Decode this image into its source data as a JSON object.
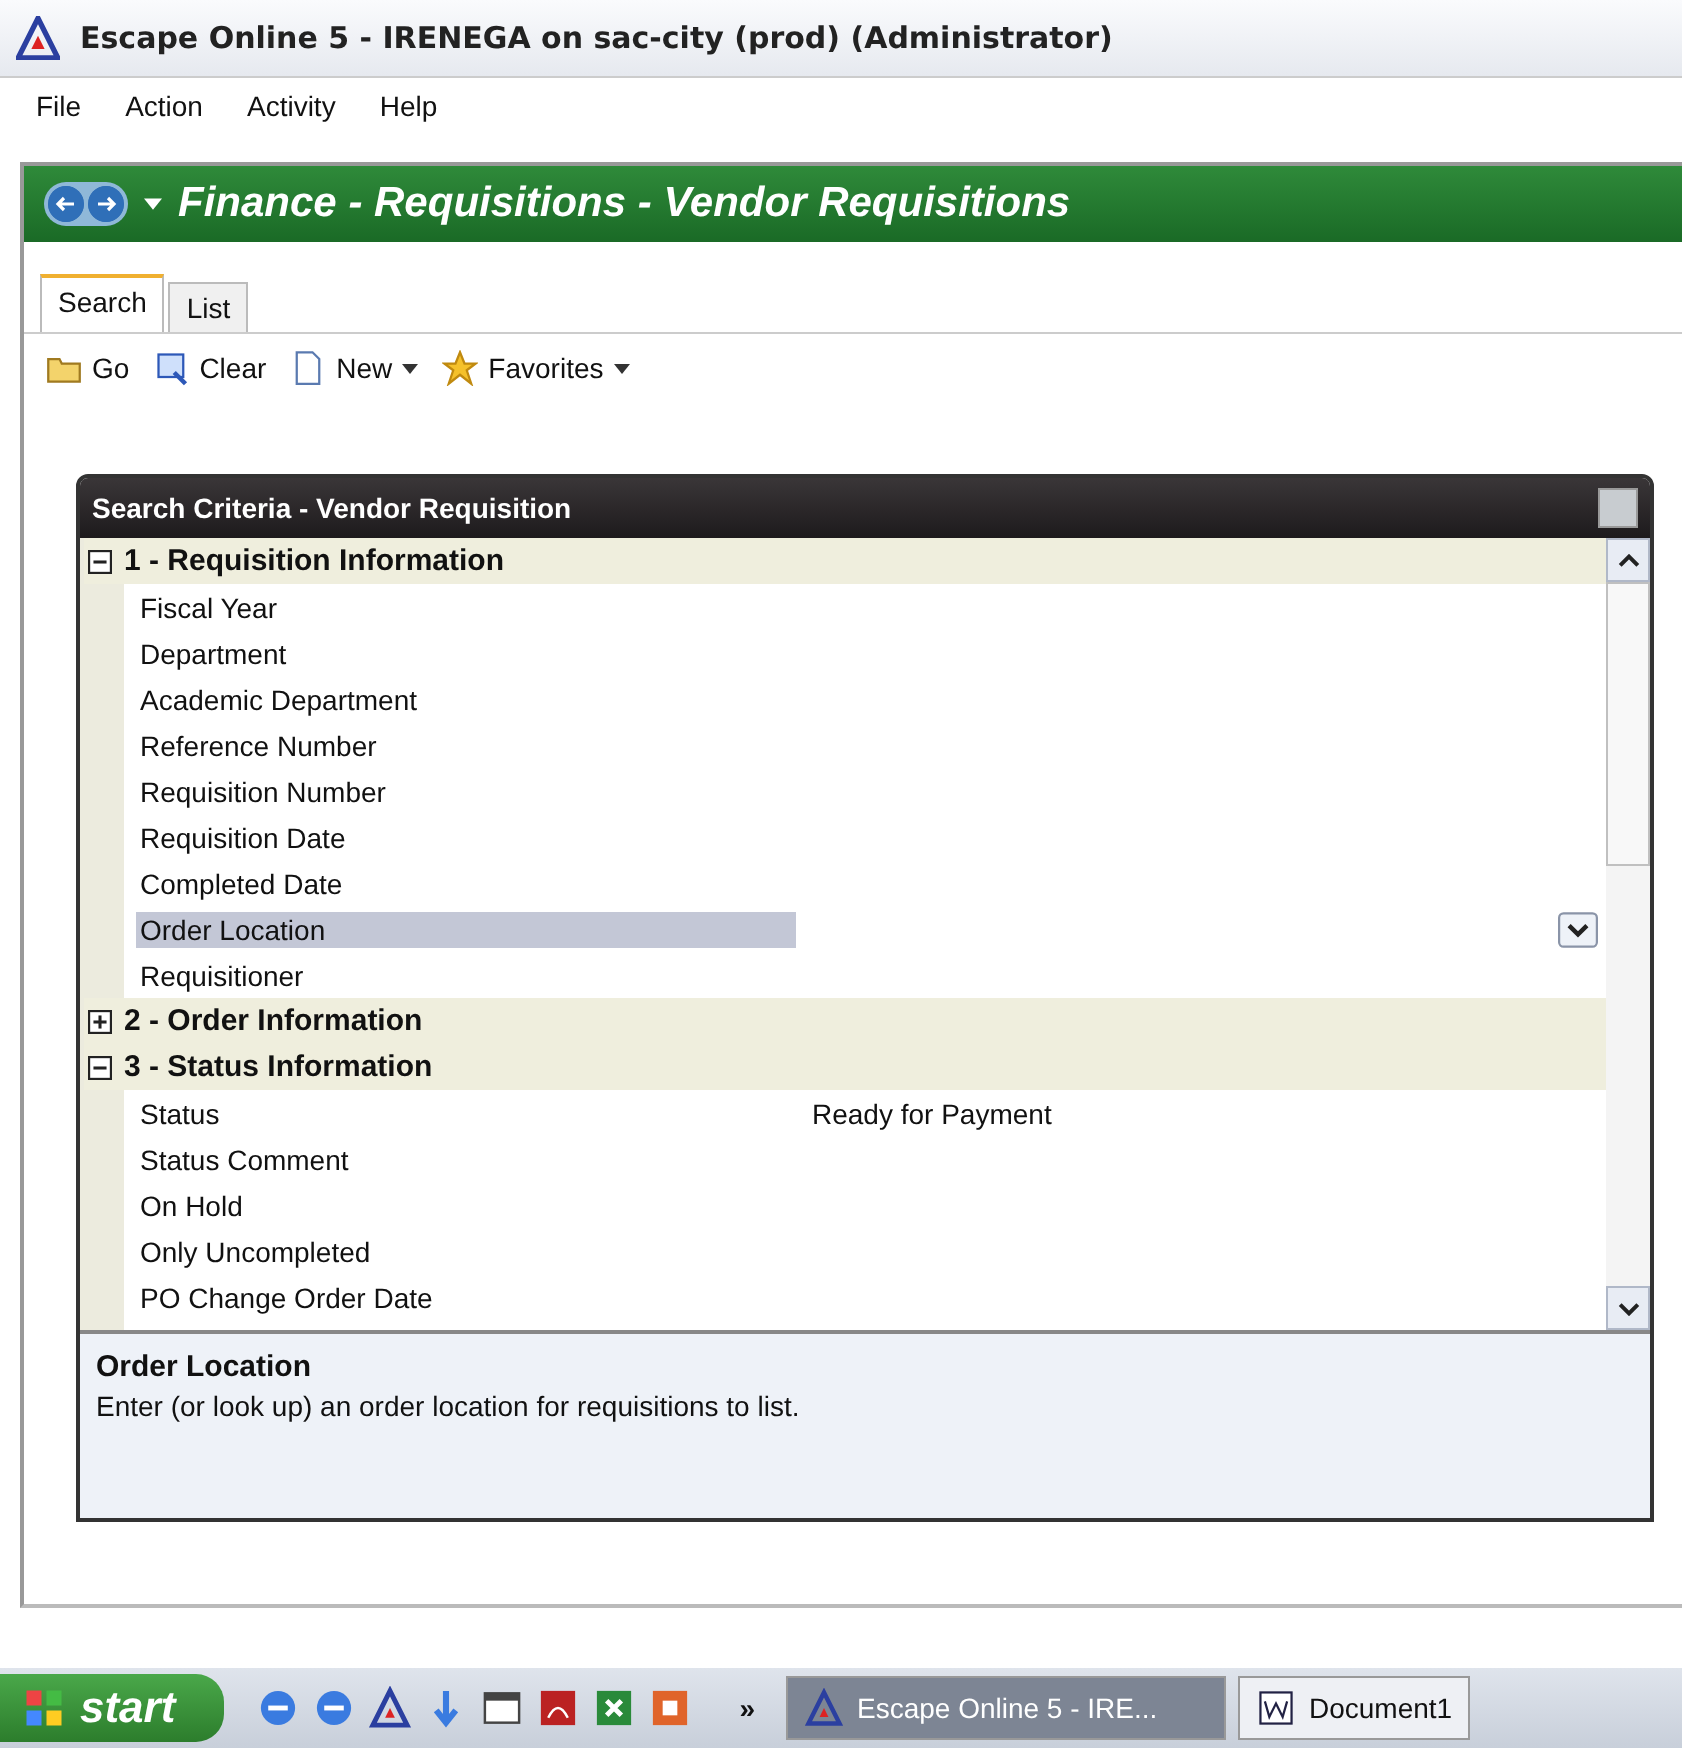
{
  "window": {
    "title": "Escape Online 5 - IRENEGA on sac-city (prod) (Administrator)"
  },
  "menu": [
    "File",
    "Action",
    "Activity",
    "Help"
  ],
  "breadcrumb": "Finance - Requisitions - Vendor Requisitions",
  "tabs": [
    {
      "label": "Search",
      "selected": true
    },
    {
      "label": "List",
      "selected": false
    }
  ],
  "toolbar": [
    {
      "label": "Go",
      "kind": "folder",
      "dropdown": false
    },
    {
      "label": "Clear",
      "kind": "clear",
      "dropdown": false
    },
    {
      "label": "New",
      "kind": "page",
      "dropdown": true
    },
    {
      "label": "Favorites",
      "kind": "star",
      "dropdown": true
    }
  ],
  "panel": {
    "title": "Search Criteria - Vendor Requisition",
    "sections": [
      {
        "title": "1 - Requisition Information",
        "expanded": true,
        "items": [
          {
            "label": "Fiscal Year",
            "selected": false
          },
          {
            "label": "Department",
            "selected": false
          },
          {
            "label": "Academic Department",
            "selected": false
          },
          {
            "label": "Reference Number",
            "selected": false
          },
          {
            "label": "Requisition Number",
            "selected": false
          },
          {
            "label": "Requisition Date",
            "selected": false
          },
          {
            "label": "Completed Date",
            "selected": false
          },
          {
            "label": "Order Location",
            "selected": true
          },
          {
            "label": "Requisitioner",
            "selected": false
          }
        ]
      },
      {
        "title": "2 - Order Information",
        "expanded": false
      },
      {
        "title": "3 - Status Information",
        "expanded": true,
        "items": [
          {
            "label": "Status",
            "value": "Ready for Payment",
            "selected": false
          },
          {
            "label": "Status Comment",
            "selected": false
          },
          {
            "label": "On Hold",
            "selected": false
          },
          {
            "label": "Only Uncompleted",
            "selected": false
          },
          {
            "label": "PO Change Order Date",
            "selected": false
          }
        ]
      }
    ],
    "help": {
      "title": "Order Location",
      "text": "Enter (or look up) an order location for requisitions to list."
    }
  },
  "taskbar": {
    "start": "start",
    "more": "»",
    "tasks": [
      {
        "label": "Escape Online 5 - IRE...",
        "kind": "app",
        "selected": true
      },
      {
        "label": "Document1",
        "kind": "word",
        "selected": false
      }
    ],
    "quicklaunch": [
      {
        "kind": "ie"
      },
      {
        "kind": "ie"
      },
      {
        "kind": "app"
      },
      {
        "kind": "down"
      },
      {
        "kind": "window"
      },
      {
        "kind": "acrobat"
      },
      {
        "kind": "excel"
      },
      {
        "kind": "ppt"
      }
    ]
  }
}
